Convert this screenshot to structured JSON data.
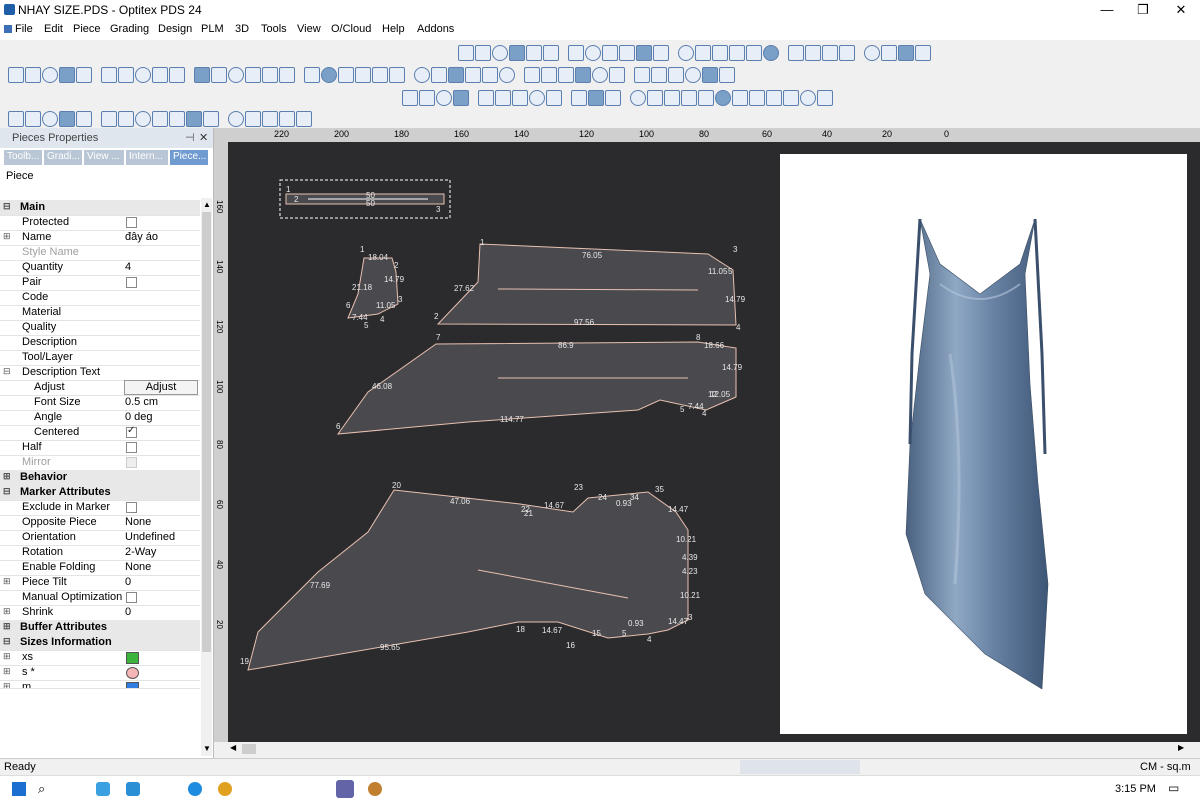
{
  "window": {
    "title": "NHAY SIZE.PDS - Optitex PDS 24",
    "minimize": "—",
    "restore": "❐",
    "close": "✕"
  },
  "menu": [
    "File",
    "Edit",
    "Piece",
    "Grading",
    "Design",
    "PLM",
    "3D",
    "Tools",
    "View",
    "O/Cloud",
    "Help",
    "Addons"
  ],
  "panel": {
    "title": "Pieces Properties",
    "pin": "⊣",
    "close": "✕",
    "tabs": [
      "Toolb...",
      "Gradi...",
      "View ...",
      "Intern...",
      "Piece..."
    ],
    "header": "Piece",
    "rows": {
      "main": "Main",
      "protected": "Protected",
      "name": "Name",
      "name_val": "đây áo",
      "style_name": "Style Name",
      "quantity": "Quantity",
      "quantity_val": "4",
      "pair": "Pair",
      "code": "Code",
      "material": "Material",
      "quality": "Quality",
      "description": "Description",
      "tool_layer": "Tool/Layer",
      "description_text": "Description Text",
      "adjust": "Adjust",
      "adjust_btn": "Adjust",
      "font_size": "Font Size",
      "font_size_val": "0.5 cm",
      "angle": "Angle",
      "angle_val": "0 deg",
      "centered": "Centered",
      "half": "Half",
      "mirror": "Mirror",
      "behavior": "Behavior",
      "marker_attributes": "Marker Attributes",
      "exclude_in_marker": "Exclude in Marker",
      "opposite_piece": "Opposite Piece",
      "opposite_piece_val": "None",
      "orientation": "Orientation",
      "orientation_val": "Undefined",
      "rotation": "Rotation",
      "rotation_val": "2-Way",
      "enable_folding": "Enable Folding",
      "enable_folding_val": "None",
      "piece_tilt": "Piece Tilt",
      "piece_tilt_val": "0",
      "manual_optimization": "Manual Optimization",
      "shrink": "Shrink",
      "shrink_val": "0",
      "buffer_attributes": "Buffer Attributes",
      "sizes_information": "Sizes Information",
      "size_xs": "xs",
      "size_s": "s *",
      "size_m": "m"
    },
    "colors": {
      "xs": "#3cb43c",
      "s": "#f4b6b6",
      "m": "#2f7de0"
    }
  },
  "ruler": {
    "top": [
      "220",
      "200",
      "180",
      "160",
      "140",
      "120",
      "100",
      "80",
      "60",
      "40",
      "20",
      "0"
    ],
    "left": [
      "160",
      "140",
      "120",
      "100",
      "80",
      "60",
      "40",
      "20"
    ]
  },
  "pieces": {
    "p1": {
      "pts": [
        "1",
        "2",
        "3"
      ],
      "dims": [
        "50",
        "50"
      ]
    },
    "p2": {
      "pts": [
        "1",
        "2",
        "3",
        "4",
        "5",
        "6"
      ],
      "dims": [
        "18.04",
        "14.79",
        "21.18",
        "11.05",
        "7.44"
      ]
    },
    "p3": {
      "pts": [
        "1",
        "2",
        "3",
        "4",
        "5"
      ],
      "dims": [
        "76.05",
        "27.62",
        "97.56",
        "14.79",
        "11.05"
      ]
    },
    "p4": {
      "pts": [
        "7",
        "8",
        "6",
        "5",
        "4",
        "12"
      ],
      "dims": [
        "86.9",
        "18.66",
        "14.79",
        "46.08",
        "114.77",
        "7.44",
        "12.05"
      ]
    },
    "p5": {
      "pts": [
        "20",
        "22",
        "23",
        "24",
        "34",
        "35",
        "21",
        "18",
        "16",
        "15",
        "5",
        "4",
        "3",
        "19"
      ],
      "dims": [
        "47.06",
        "14.67",
        "14.47",
        "10.21",
        "4.39",
        "4.23",
        "10.21",
        "77.69",
        "95.65",
        "14.67",
        "14.47",
        "0.93",
        "0.93"
      ]
    }
  },
  "status": {
    "left": "Ready",
    "units": "CM - sq.m"
  },
  "taskbar": {
    "time": "3:15 PM"
  }
}
